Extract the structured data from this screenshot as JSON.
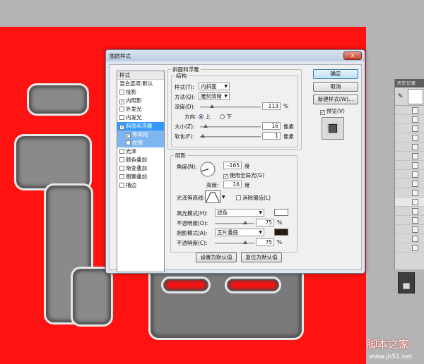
{
  "dialog": {
    "title": "图层样式",
    "close_symbol": "x",
    "styles_list": {
      "header": "样式",
      "blending_options": "混合选项:默认",
      "items": [
        {
          "label": "投影",
          "checked": false
        },
        {
          "label": "内阴影",
          "checked": true
        },
        {
          "label": "外发光",
          "checked": false
        },
        {
          "label": "内发光",
          "checked": false
        },
        {
          "label": "斜面和浮雕",
          "checked": true,
          "selected": true
        },
        {
          "label": "等高线",
          "checked": true,
          "sub": true
        },
        {
          "label": "纹理",
          "checked": false,
          "sub": true
        },
        {
          "label": "光泽",
          "checked": false
        },
        {
          "label": "颜色叠加",
          "checked": false
        },
        {
          "label": "渐变叠加",
          "checked": false
        },
        {
          "label": "图案叠加",
          "checked": false
        },
        {
          "label": "描边",
          "checked": false
        }
      ]
    },
    "bevel": {
      "section_title": "斜面和浮雕",
      "structure_title": "结构",
      "style_label": "样式(T):",
      "style_value": "内斜面",
      "technique_label": "方法(Q):",
      "technique_value": "雕刻清晰",
      "depth_label": "深度(D):",
      "depth_value": "113",
      "depth_unit": "%",
      "direction_label": "方向:",
      "direction_up": "上",
      "direction_down": "下",
      "size_label": "大小(Z):",
      "size_value": "16",
      "size_unit": "像素",
      "soften_label": "软化(F):",
      "soften_value": "1",
      "soften_unit": "像素"
    },
    "shading": {
      "title": "阴影",
      "angle_label": "角度(N):",
      "angle_value": "-165",
      "angle_unit": "度",
      "global_light_label": "使用全局光(G)",
      "altitude_label": "高度:",
      "altitude_value": "16",
      "altitude_unit": "度",
      "gloss_contour_label": "光泽等高线:",
      "anti_aliased_label": "消除锯齿(L)",
      "highlight_mode_label": "高光模式(H):",
      "highlight_mode_value": "滤色",
      "highlight_color": "#ffffff",
      "highlight_opacity_label": "不透明度(O):",
      "highlight_opacity_value": "75",
      "opacity_unit": "%",
      "shadow_mode_label": "阴影模式(A):",
      "shadow_mode_value": "正片叠底",
      "shadow_color": "#2a1712",
      "shadow_opacity_label": "不透明度(C):",
      "shadow_opacity_value": "75"
    },
    "make_default": "设置为默认值",
    "reset_default": "复位为默认值",
    "ok": "确定",
    "cancel": "取消",
    "new_style": "新建样式(W)...",
    "preview_label": "预览(V)"
  },
  "history_panel": {
    "title": "历史记录"
  },
  "watermark": {
    "text": "脚本之家",
    "url": "www.jb51.net"
  },
  "colors": {
    "canvas_red": "#ff1212",
    "selection_blue": "#3399ff"
  }
}
